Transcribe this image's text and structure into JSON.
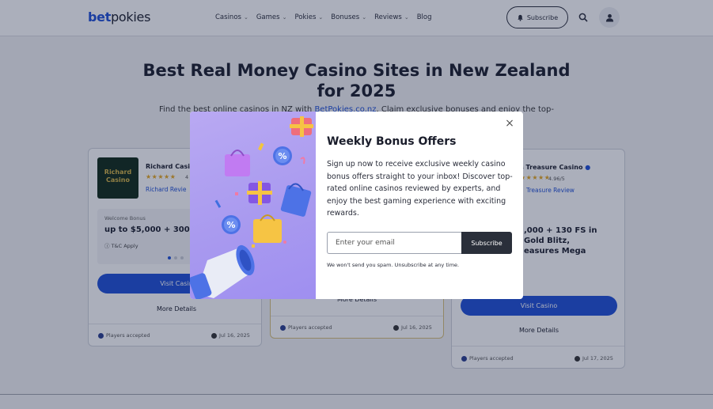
{
  "header": {
    "logo_part1": "bet",
    "logo_part2": "pokies",
    "nav": [
      {
        "label": "Casinos",
        "has_dropdown": true
      },
      {
        "label": "Games",
        "has_dropdown": true
      },
      {
        "label": "Pokies",
        "has_dropdown": true
      },
      {
        "label": "Bonuses",
        "has_dropdown": true
      },
      {
        "label": "Reviews",
        "has_dropdown": true
      },
      {
        "label": "Blog",
        "has_dropdown": false
      }
    ],
    "subscribe_label": "Subscribe"
  },
  "main": {
    "title_line1": "Best Real Money Casino Sites in New Zealand",
    "title_line2": "for 2025",
    "subtitle_pre": "Find the best online casinos in NZ with ",
    "subtitle_link": "BetPokies.co.nz",
    "subtitle_post": ". Claim exclusive bonuses and enjoy the top-"
  },
  "cards": [
    {
      "logo_text": "Richard Casino",
      "name": "Richard Casin",
      "stars": "★★★★★",
      "rating": "4",
      "review_link": "Richard Revie",
      "welcome_label": "Welcome Bonus",
      "bonus": "up to $5,000 + 300 F",
      "tc": "T&C Apply",
      "visit_label": "Visit Casin",
      "more_label": "More Details",
      "players": "Players accepted",
      "date": "Jul 16, 2025"
    },
    {
      "more_label": "More Details",
      "players": "Players accepted",
      "date": "Jul 16, 2025"
    },
    {
      "name": "s Treasure Casino",
      "stars": "★★★★★",
      "rating": "4.96/5",
      "review_link": "Treasure Review",
      "bonus_line1": ",000 + 130 FS in",
      "bonus_line2": "Gold Blitz,",
      "bonus_line3": "easures Mega",
      "visit_label": "Visit Casino",
      "more_label": "More Details",
      "players": "Players accepted",
      "date": "Jul 17, 2025"
    }
  ],
  "modal": {
    "title": "Weekly Bonus Offers",
    "body": "Sign up now to receive exclusive weekly casino bonus offers straight to your inbox! Discover top-rated online casinos reviewed by experts, and enjoy the best gaming experience with exciting rewards.",
    "email_placeholder": "Enter your email",
    "subscribe_label": "Subscribe",
    "disclaimer": "We won't send you spam. Unsubscribe at any time.",
    "close_symbol": "×"
  },
  "colors": {
    "brand_blue": "#1e4fd6",
    "dark_button": "#2a2f3a",
    "art_purple": "#a99aef",
    "star": "#e7a71c"
  }
}
